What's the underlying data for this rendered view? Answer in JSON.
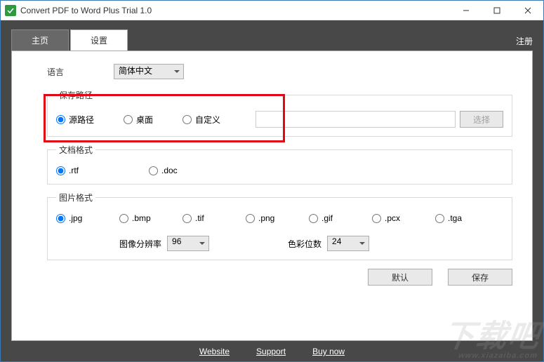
{
  "window": {
    "title": "Convert PDF to Word Plus Trial 1.0"
  },
  "tabs": {
    "home": "主页",
    "settings": "设置"
  },
  "register": "注册",
  "language": {
    "label": "语言",
    "value": "简体中文"
  },
  "savepath": {
    "legend": "保存路径",
    "src": "源路径",
    "desktop": "桌面",
    "custom": "自定义",
    "browse": "选择"
  },
  "docformat": {
    "legend": "文档格式",
    "rtf": ".rtf",
    "doc": ".doc"
  },
  "imgformat": {
    "legend": "图片格式",
    "jpg": ".jpg",
    "bmp": ".bmp",
    "tif": ".tif",
    "png": ".png",
    "gif": ".gif",
    "pcx": ".pcx",
    "tga": ".tga",
    "res_label": "图像分辨率",
    "res_value": "96",
    "depth_label": "色彩位数",
    "depth_value": "24"
  },
  "buttons": {
    "default": "默认",
    "save": "保存"
  },
  "footer": {
    "website": "Website",
    "support": "Support",
    "buy": "Buy now"
  }
}
